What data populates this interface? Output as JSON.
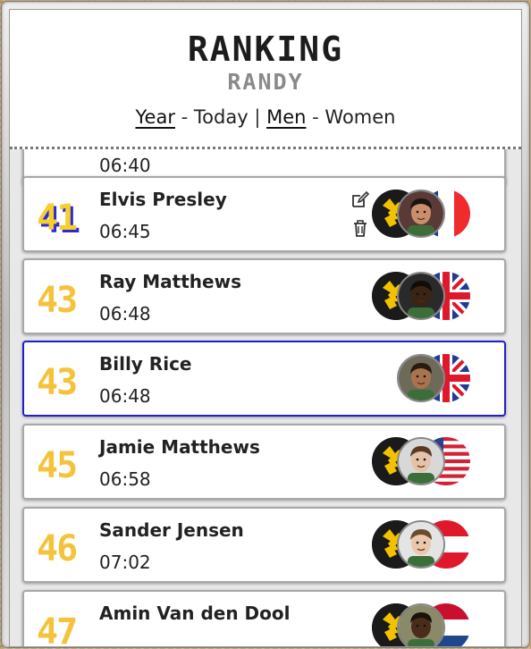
{
  "header": {
    "title": "RANKING",
    "subtitle": "RANDY",
    "filter_year": "Year",
    "filter_today": "Today",
    "filter_men": "Men",
    "filter_women": "Women",
    "dash": "-",
    "divider": "|"
  },
  "ranking": [
    {
      "rank": "41",
      "name": "Elvis Presley",
      "time": "06:45",
      "club": true,
      "photo_skin": "#c98f6d",
      "photo_hair": "#1b1410",
      "photo_bg": "#5a3a36",
      "flag": "france",
      "editable": true,
      "highlight": false,
      "rank_style": "shadow"
    },
    {
      "rank": "43",
      "name": "Ray Matthews",
      "time": "06:48",
      "club": true,
      "photo_skin": "#3b2414",
      "photo_hair": "#120c08",
      "photo_bg": "#2a2a2a",
      "flag": "uk",
      "editable": false,
      "highlight": false,
      "rank_style": "plain"
    },
    {
      "rank": "43",
      "name": "Billy Rice",
      "time": "06:48",
      "club": false,
      "photo_skin": "#a8744e",
      "photo_hair": "#2a1a10",
      "photo_bg": "#6e6a5a",
      "flag": "uk",
      "editable": false,
      "highlight": true,
      "rank_style": "plain"
    },
    {
      "rank": "45",
      "name": "Jamie Matthews",
      "time": "06:58",
      "club": true,
      "photo_skin": "#e6c2a8",
      "photo_hair": "#5a3a22",
      "photo_bg": "#d8d8d8",
      "flag": "usa",
      "editable": false,
      "highlight": false,
      "rank_style": "plain"
    },
    {
      "rank": "46",
      "name": "Sander Jensen",
      "time": "07:02",
      "club": true,
      "photo_skin": "#ecc7ad",
      "photo_hair": "#6b4a2e",
      "photo_bg": "#e4e4e4",
      "flag": "austria",
      "editable": false,
      "highlight": false,
      "rank_style": "plain"
    },
    {
      "rank": "47",
      "name": "Amin Van den Dool",
      "time": "",
      "club": true,
      "photo_skin": "#4a2c1a",
      "photo_hair": "#1a110a",
      "photo_bg": "#8a8a6a",
      "flag": "netherlands",
      "editable": false,
      "highlight": false,
      "rank_style": "plain"
    }
  ],
  "partial_top_row": {
    "time": "06:40"
  },
  "colors": {
    "rank_yellow": "#f5c33b",
    "highlight_border": "#1f1fd0",
    "card_border": "#a8a8a8"
  },
  "icons": {
    "edit": "pencil-square-icon",
    "delete": "trash-icon",
    "club": "club-logo-icon"
  }
}
